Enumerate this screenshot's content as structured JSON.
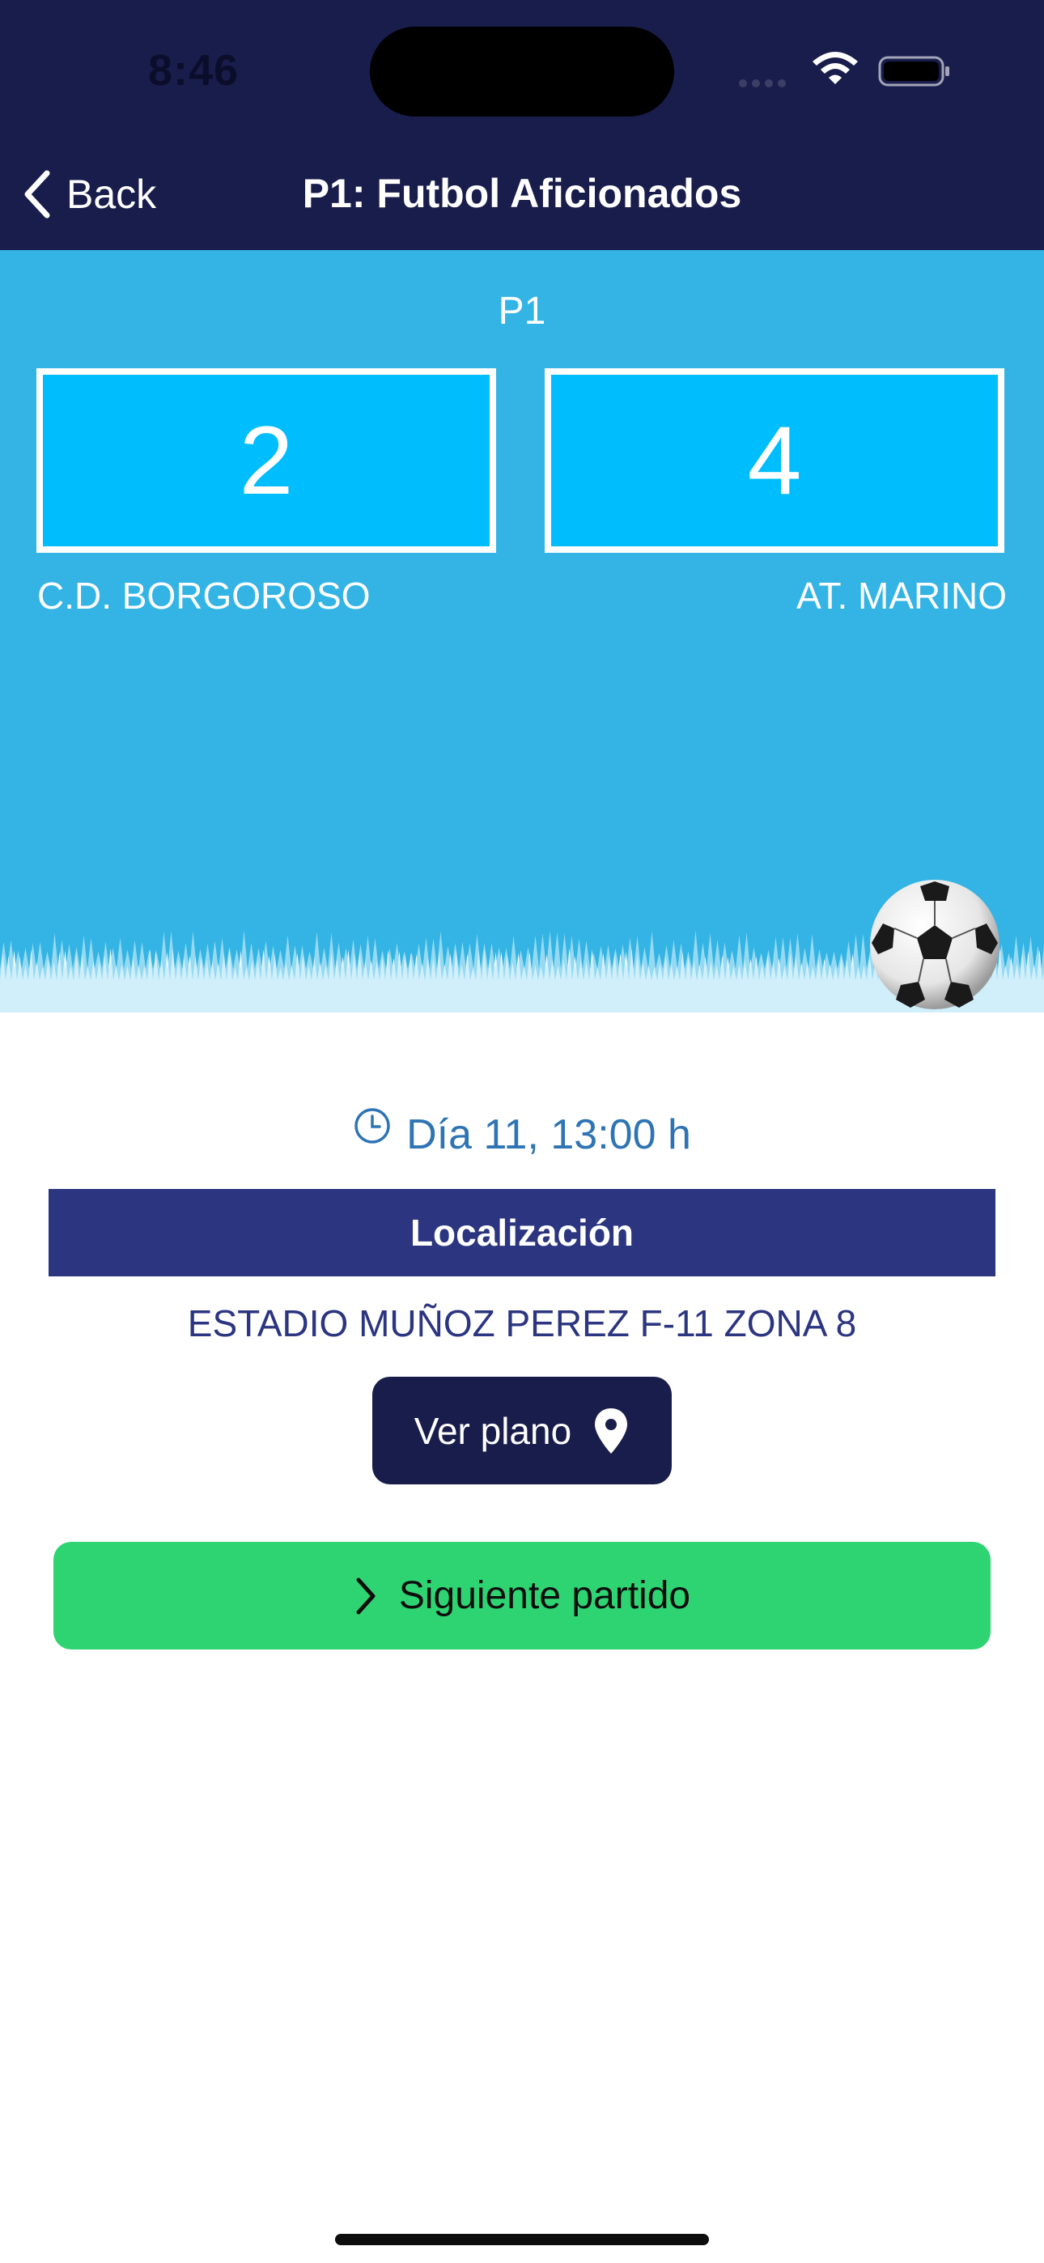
{
  "status_bar": {
    "time": "8:46"
  },
  "nav": {
    "back_label": "Back",
    "title": "P1: Futbol Aficionados"
  },
  "match": {
    "code": "P1",
    "home_score": "2",
    "away_score": "4",
    "home_team": "C.D. BORGOROSO",
    "away_team": "AT. MARINO"
  },
  "details": {
    "datetime": "Día 11, 13:00 h",
    "location_header": "Localización",
    "venue": "ESTADIO MUÑOZ PEREZ F-11 ZONA 8",
    "map_button_label": "Ver plano",
    "next_button_label": "Siguiente partido"
  },
  "icons": {
    "back": "chevron-left-icon",
    "clock": "clock-icon",
    "pin": "map-pin-icon",
    "next": "chevron-right-icon",
    "ball": "soccer-ball-icon"
  },
  "colors": {
    "header_bg": "#191d4b",
    "score_bg": "#34b4e4",
    "score_box_bg": "#00befe",
    "location_header_bg": "#2b3580",
    "datetime_text": "#2e74b5",
    "next_button_bg": "#2fd472"
  }
}
